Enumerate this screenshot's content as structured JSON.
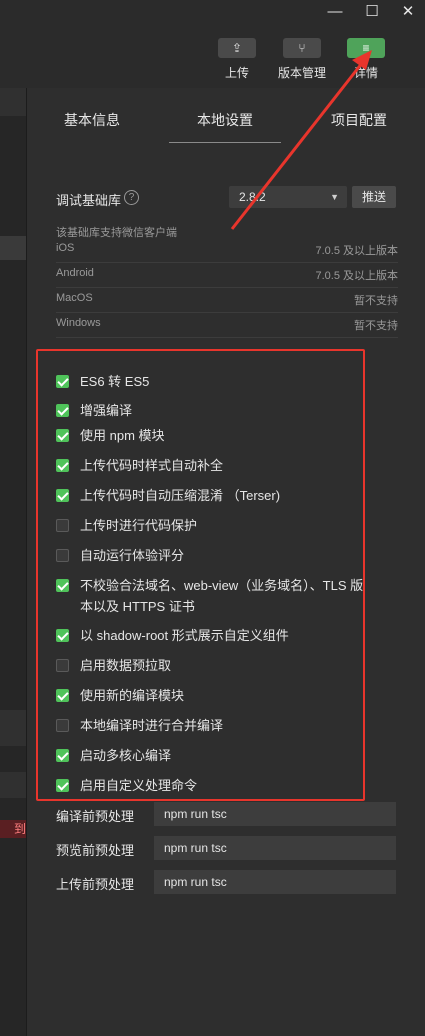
{
  "window": {
    "minimize_glyph": "—",
    "maximize_glyph": "☐",
    "close_glyph": "✕"
  },
  "toolbar": {
    "upload": {
      "label": "上传",
      "icon": "upload-icon",
      "glyph": "⇪"
    },
    "version": {
      "label": "版本管理",
      "icon": "branch-icon",
      "glyph": "⑂"
    },
    "details": {
      "label": "详情",
      "icon": "menu-icon",
      "glyph": "≡",
      "color": "#4fa35a"
    }
  },
  "tabs": [
    {
      "label": "基本信息"
    },
    {
      "label": "本地设置"
    },
    {
      "label": "项目配置"
    }
  ],
  "library": {
    "label": "调试基础库",
    "help_glyph": "?",
    "version": "2.8.2",
    "caret": "▼",
    "push_label": "推送"
  },
  "support_note": "该基础库支持微信客户端",
  "support": [
    {
      "name": "iOS",
      "value": "7.0.5 及以上版本"
    },
    {
      "name": "Android",
      "value": "7.0.5 及以上版本"
    },
    {
      "name": "MacOS",
      "value": "暂不支持"
    },
    {
      "name": "Windows",
      "value": "暂不支持"
    }
  ],
  "options": [
    {
      "label": "ES6 转 ES5",
      "checked": true
    },
    {
      "label": "增强编译",
      "checked": true
    },
    {
      "label": "使用 npm 模块",
      "checked": true
    },
    {
      "label": "上传代码时样式自动补全",
      "checked": true
    },
    {
      "label": "上传代码时自动压缩混淆 （Terser)",
      "checked": true
    },
    {
      "label": "上传时进行代码保护",
      "checked": false
    },
    {
      "label": "自动运行体验评分",
      "checked": false
    },
    {
      "label": "不校验合法域名、web-view（业务域名）、TLS 版本以及 HTTPS 证书",
      "checked": true
    },
    {
      "label": "以 shadow-root 形式展示自定义组件",
      "checked": true
    },
    {
      "label": "启用数据预拉取",
      "checked": false
    },
    {
      "label": "使用新的编译模块",
      "checked": true
    },
    {
      "label": "本地编译时进行合并编译",
      "checked": false
    },
    {
      "label": "启动多核心编译",
      "checked": true
    },
    {
      "label": "启用自定义处理命令",
      "checked": true
    }
  ],
  "preprocess": [
    {
      "label": "编译前预处理",
      "value": "npm run tsc"
    },
    {
      "label": "预览前预处理",
      "value": "npm run tsc"
    },
    {
      "label": "上传前预处理",
      "value": "npm run tsc"
    }
  ],
  "left_pane": {
    "error_text": "到"
  },
  "colors": {
    "highlight_box": "#e8352c",
    "checkbox_on": "#4fc35a",
    "accent": "#4fa35a"
  }
}
